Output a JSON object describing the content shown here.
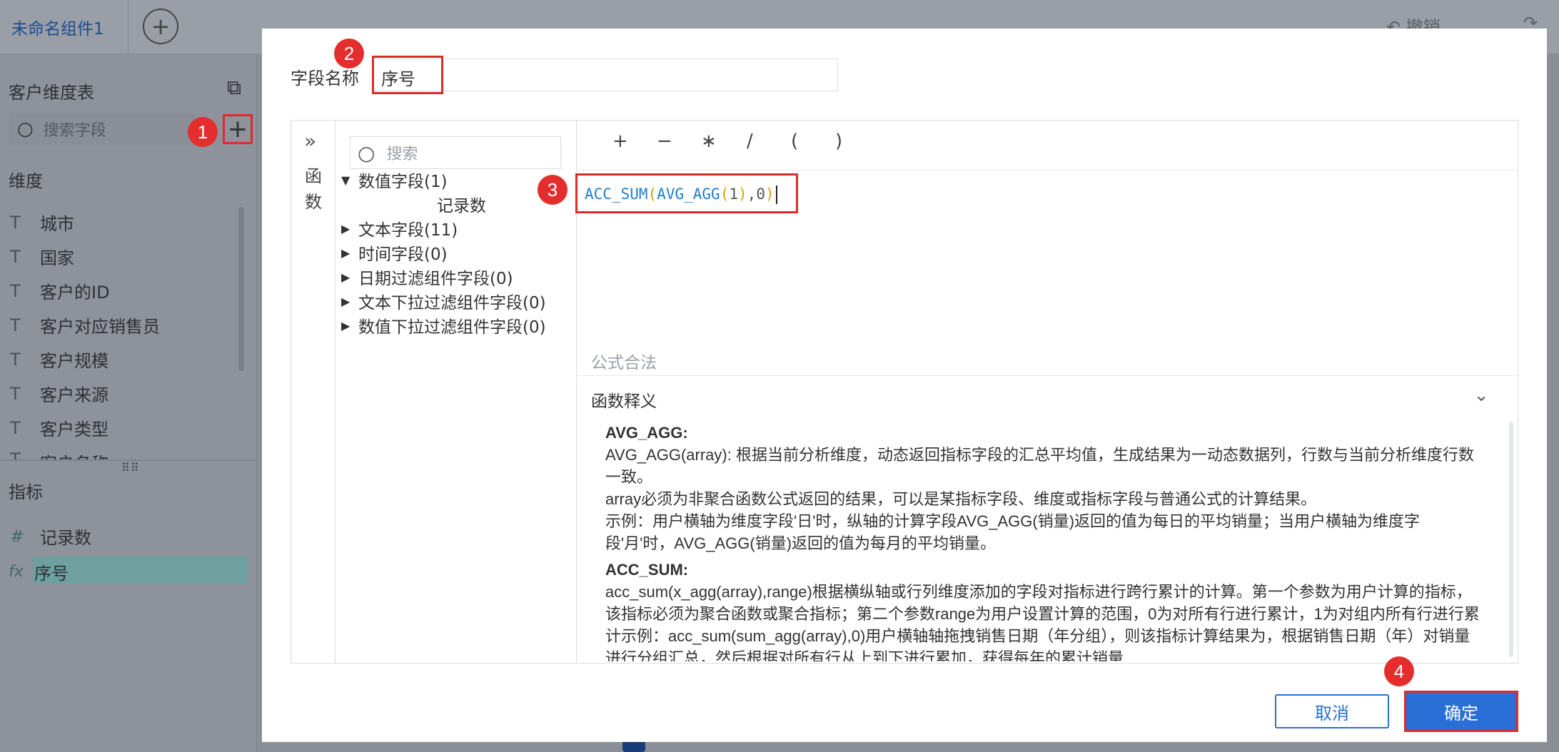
{
  "app": {
    "tab_label": "未命名组件1",
    "add_tab_symbol": "+",
    "undo_label": "撤销",
    "redo_label": "重"
  },
  "sidebar": {
    "table_name": "客户维度表",
    "search_placeholder": "搜索字段",
    "add_symbol": "+",
    "dimensions_title": "维度",
    "dimension_items": [
      "城市",
      "国家",
      "客户的ID",
      "客户对应销售员",
      "客户规模",
      "客户来源",
      "客户类型",
      "客户名称"
    ],
    "measures_title": "指标",
    "measure_items": [
      {
        "icon": "#",
        "label": "记录数"
      },
      {
        "icon": "fx",
        "label": "序号"
      }
    ]
  },
  "dialog": {
    "field_name_label": "字段名称",
    "field_name_value": "序号",
    "functions_toggle_label": "函数",
    "field_search_placeholder": "搜索",
    "tree": [
      {
        "label": "数值字段(1)",
        "expanded": true,
        "children": [
          "记录数"
        ]
      },
      {
        "label": "文本字段(11)",
        "expanded": false
      },
      {
        "label": "时间字段(0)",
        "expanded": false
      },
      {
        "label": "日期过滤组件字段(0)",
        "expanded": false
      },
      {
        "label": "文本下拉过滤组件字段(0)",
        "expanded": false
      },
      {
        "label": "数值下拉过滤组件字段(0)",
        "expanded": false
      }
    ],
    "operators": [
      "+",
      "−",
      "∗",
      "/",
      "(",
      ")"
    ],
    "formula": {
      "fn1": "ACC_SUM",
      "fn2": "AVG_AGG",
      "open": "(",
      "close": ")",
      "arg1": "1",
      "comma": ",",
      "arg2": "0"
    },
    "formula_status": "公式合法",
    "explain_title": "函数释义",
    "explain": {
      "avg_name": "AVG_AGG:",
      "avg_line1": "AVG_AGG(array): 根据当前分析维度，动态返回指标字段的汇总平均值，生成结果为一动态数据列，行数与当前分析维度行数一致。",
      "avg_line2": " array必须为非聚合函数公式返回的结果，可以是某指标字段、维度或指标字段与普通公式的计算结果。",
      "avg_line3": " 示例：用户横轴为维度字段'日'时，纵轴的计算字段AVG_AGG(销量)返回的值为每日的平均销量；当用户横轴为维度字段'月'时，AVG_AGG(销量)返回的值为每月的平均销量。",
      "acc_name": "ACC_SUM:",
      "acc_line1": "acc_sum(x_agg(array),range)根据横纵轴或行列维度添加的字段对指标进行跨行累计的计算。第一个参数为用户计算的指标，该指标必须为聚合函数或聚合指标；第二个参数range为用户设置计算的范围，0为对所有行进行累计，1为对组内所有行进行累计示例：acc_sum(sum_agg(array),0)用户横轴轴拖拽销售日期（年分组），则该指标计算结果为，根据销售日期（年）对销量进行分组汇总，然后根据对所有行从上到下进行累加，获得每年的累计销量"
    },
    "cancel_label": "取消",
    "ok_label": "确定"
  },
  "badges": [
    "1",
    "2",
    "3",
    "4"
  ],
  "colors": {
    "primary": "#2a6fd6",
    "highlight_red": "#e02a2a",
    "badge_red": "#e42d2d",
    "formula_fn": "#1f7fd0",
    "formula_paren": "#d3a300"
  }
}
